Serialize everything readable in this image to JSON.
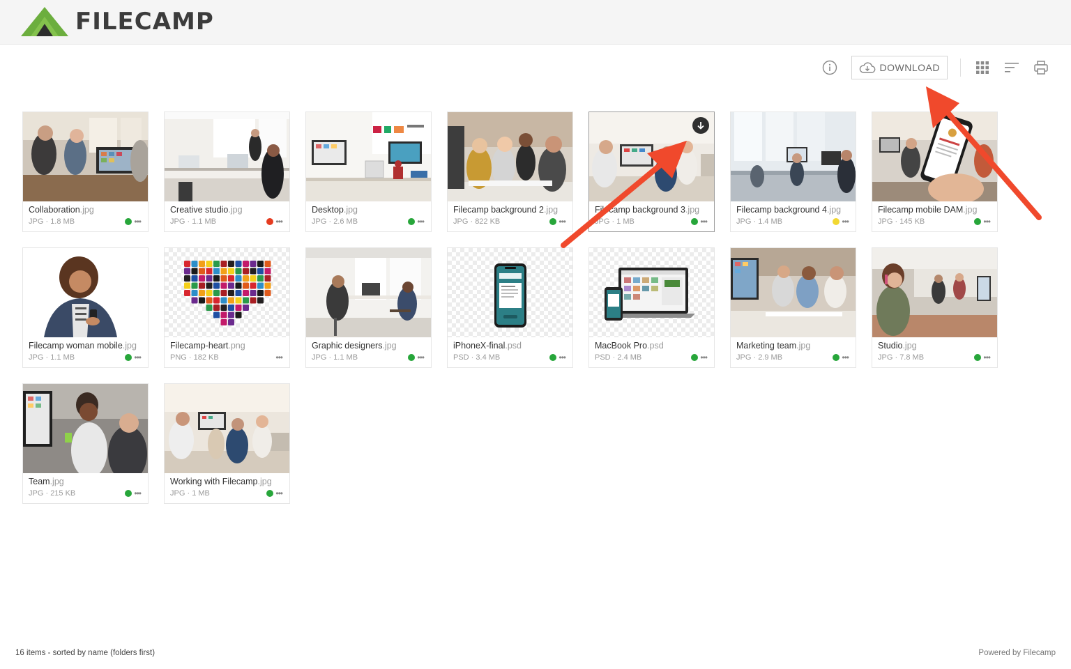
{
  "brand": {
    "name": "FILECAMP"
  },
  "toolbar": {
    "download_label": "DOWNLOAD"
  },
  "colors": {
    "green": "#27a63a",
    "red": "#e53b20",
    "yellow": "#f2d832",
    "logo_green": "#6cae3e",
    "arrow": "#f0492c"
  },
  "files": [
    {
      "base": "Collaboration",
      "ext": ".jpg",
      "type": "JPG",
      "size": "1.8 MB",
      "status": "green",
      "thumb": "office"
    },
    {
      "base": "Creative studio",
      "ext": ".jpg",
      "type": "JPG",
      "size": "1.1 MB",
      "status": "red",
      "thumb": "studio"
    },
    {
      "base": "Desktop",
      "ext": ".jpg",
      "type": "JPG",
      "size": "2.6 MB",
      "status": "green",
      "thumb": "desk"
    },
    {
      "base": "Filecamp background 2",
      "ext": ".jpg",
      "type": "JPG",
      "size": "822 KB",
      "status": "green",
      "thumb": "team"
    },
    {
      "base": "Filecamp background 3",
      "ext": ".jpg",
      "type": "JPG",
      "size": "1 MB",
      "status": "green",
      "thumb": "meeting"
    },
    {
      "base": "Filecamp background 4",
      "ext": ".jpg",
      "type": "JPG",
      "size": "1.4 MB",
      "status": "yellow",
      "thumb": "openoffice"
    },
    {
      "base": "Filecamp mobile DAM",
      "ext": ".jpg",
      "type": "JPG",
      "size": "145 KB",
      "status": "green",
      "thumb": "phonehand"
    },
    {
      "base": "Filecamp woman mobile",
      "ext": ".jpg",
      "type": "JPG",
      "size": "1.1 MB",
      "status": "green",
      "thumb": "woman"
    },
    {
      "base": "Filecamp-heart",
      "ext": ".png",
      "type": "PNG",
      "size": "182 KB",
      "status": "none",
      "thumb": "heart"
    },
    {
      "base": "Graphic designers",
      "ext": ".jpg",
      "type": "JPG",
      "size": "1.1 MB",
      "status": "green",
      "thumb": "designers"
    },
    {
      "base": "iPhoneX-final",
      "ext": ".psd",
      "type": "PSD",
      "size": "3.4 MB",
      "status": "green",
      "thumb": "iphone"
    },
    {
      "base": "MacBook Pro",
      "ext": ".psd",
      "type": "PSD",
      "size": "2.4 MB",
      "status": "green",
      "thumb": "macbook"
    },
    {
      "base": "Marketing team",
      "ext": ".jpg",
      "type": "JPG",
      "size": "2.9 MB",
      "status": "green",
      "thumb": "marketing"
    },
    {
      "base": "Studio",
      "ext": ".jpg",
      "type": "JPG",
      "size": "7.8 MB",
      "status": "green",
      "thumb": "studio2"
    },
    {
      "base": "Team",
      "ext": ".jpg",
      "type": "JPG",
      "size": "215 KB",
      "status": "green",
      "thumb": "teamclose"
    },
    {
      "base": "Working with Filecamp",
      "ext": ".jpg",
      "type": "JPG",
      "size": "1 MB",
      "status": "green",
      "thumb": "working"
    }
  ],
  "footer": {
    "summary": "16 items - sorted by name (folders first)",
    "powered": "Powered by Filecamp"
  }
}
